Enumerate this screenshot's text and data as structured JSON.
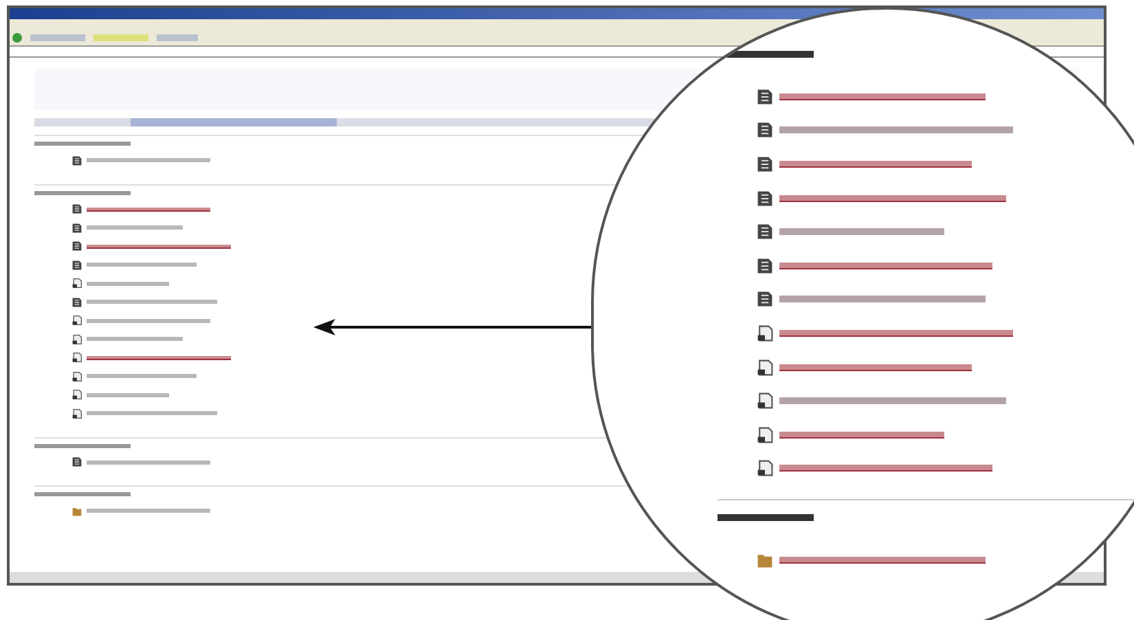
{
  "browser": {
    "sections": [
      {
        "items": [
          {
            "kind": "pagetext"
          }
        ]
      },
      {
        "items": [
          {
            "kind": "pagelink"
          },
          {
            "kind": "pagetext"
          },
          {
            "kind": "pagelink"
          },
          {
            "kind": "pagetext"
          },
          {
            "kind": "doctext"
          },
          {
            "kind": "pagetext"
          },
          {
            "kind": "doctext"
          },
          {
            "kind": "doctext"
          },
          {
            "kind": "doclink"
          },
          {
            "kind": "doctext"
          },
          {
            "kind": "doctext"
          },
          {
            "kind": "doctext"
          }
        ]
      },
      {
        "items": [
          {
            "kind": "pagetext"
          }
        ]
      },
      {
        "items": [
          {
            "kind": "foldertext"
          }
        ]
      }
    ]
  },
  "magnifier": {
    "sections": [
      {
        "items": [
          {
            "kind": "pagelink"
          },
          {
            "kind": "pagetext"
          },
          {
            "kind": "pagelink"
          },
          {
            "kind": "pagelink"
          },
          {
            "kind": "pagetext"
          },
          {
            "kind": "pagelink"
          },
          {
            "kind": "pagetext"
          },
          {
            "kind": "doclink"
          },
          {
            "kind": "doclink"
          },
          {
            "kind": "doctext"
          },
          {
            "kind": "doclink"
          },
          {
            "kind": "doclink"
          }
        ]
      },
      {
        "items": [
          {
            "kind": "folderlink"
          }
        ]
      }
    ]
  }
}
